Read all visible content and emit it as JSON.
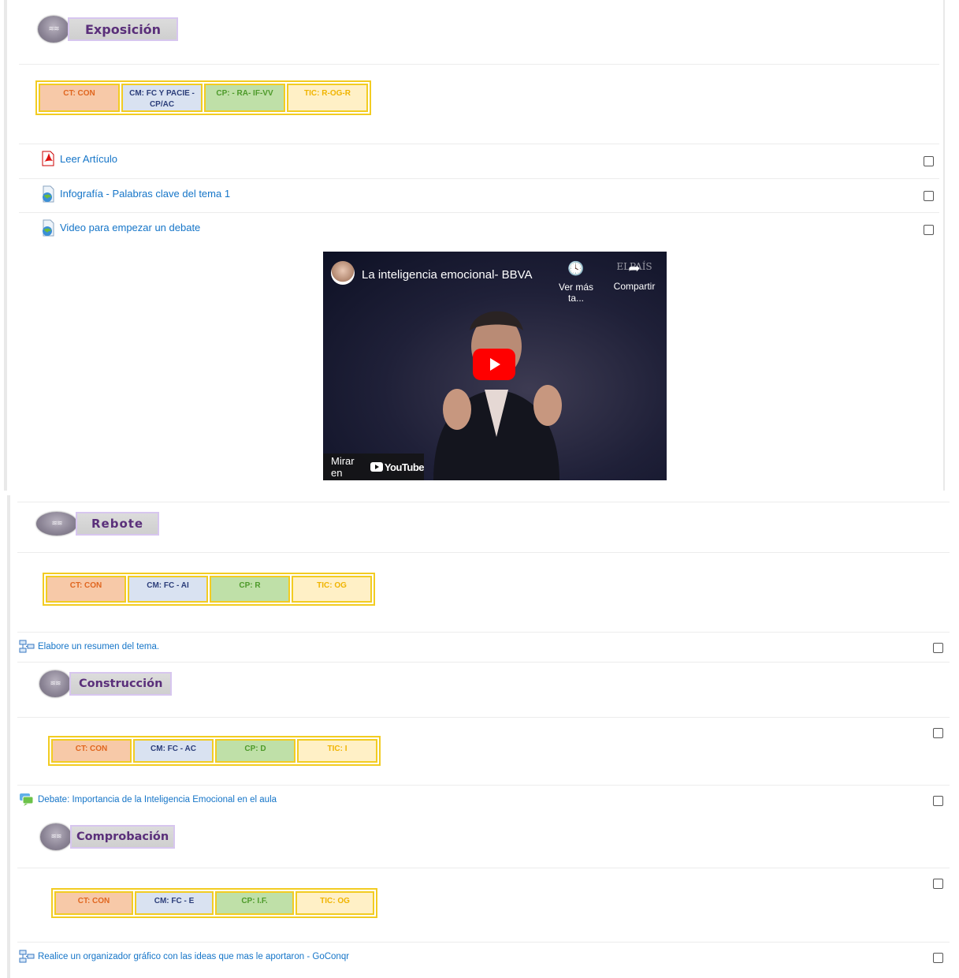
{
  "sections": {
    "exposicion": {
      "title": "Exposición",
      "ct": "CT: CON",
      "cm": "CM: FC Y PACIE - CP/AC",
      "cp": "CP:  - RA- IF-VV",
      "tic": "TIC: R-OG-R",
      "activities": [
        {
          "label": "Leer Artículo",
          "icon": "pdf-icon"
        },
        {
          "label": "Infografía - Palabras clave del tema 1",
          "icon": "globe-page-icon"
        },
        {
          "label": "Video para empezar un debate",
          "icon": "globe-page-icon"
        }
      ]
    },
    "rebote": {
      "title": "Rebote",
      "ct": "CT: CON",
      "cm": "CM: FC - AI",
      "cp": "CP: R",
      "tic": "TIC: OG",
      "activity": {
        "label": "Elabore un resumen del tema.",
        "icon": "flowchart-icon"
      }
    },
    "construccion": {
      "title": "Construcción",
      "ct": "CT: CON",
      "cm": "CM: FC - AC",
      "cp": "CP: D",
      "tic": "TIC: I",
      "activity": {
        "label": "Debate: Importancia de la Inteligencia Emocional en el aula",
        "icon": "forum-icon"
      }
    },
    "comprobacion": {
      "title": "Comprobación",
      "ct": "CT: CON",
      "cm": "CM: FC - E",
      "cp": "CP: I.F.",
      "tic": "TIC: OG",
      "activity": {
        "label": "Realice un organizador gráfico con las ideas que mas le aportaron - GoConqr",
        "icon": "flowchart-icon"
      }
    }
  },
  "video": {
    "title": "La inteligencia emocional- BBVA",
    "watch_later": "Ver más ta...",
    "share": "Compartir",
    "watch_on": "Mirar en",
    "youtube": "YouTube",
    "channel_tag": "ELPAÍS"
  },
  "colors": {
    "link": "#1575c8",
    "table_border": "#f2cc22",
    "ct_bg": "#f7c9a8",
    "cm_bg": "#d9e2f1",
    "cp_bg": "#bfe0a8",
    "tic_bg": "#fff0c6",
    "title_text": "#5a2f7a"
  }
}
